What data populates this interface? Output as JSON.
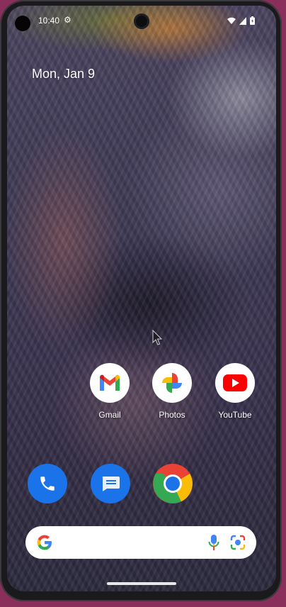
{
  "status_bar": {
    "time": "10:40",
    "gear_glyph": "⚙",
    "icons": [
      "wifi-icon",
      "signal-icon",
      "battery-icon"
    ]
  },
  "home": {
    "date": "Mon, Jan 9"
  },
  "apps": [
    {
      "label": "Gmail",
      "icon": "gmail-icon"
    },
    {
      "label": "Photos",
      "icon": "photos-icon"
    },
    {
      "label": "YouTube",
      "icon": "youtube-icon"
    }
  ],
  "dock": [
    {
      "icon": "phone-icon",
      "color": "#1a73e8"
    },
    {
      "icon": "messages-icon",
      "color": "#1a73e8"
    },
    {
      "icon": "chrome-icon"
    }
  ],
  "search": {
    "icons": [
      "google-g-icon",
      "mic-icon",
      "lens-icon"
    ]
  },
  "colors": {
    "frame": "#1a1a1c",
    "outer_background": "#8a2e5c",
    "google_blue": "#4285f4",
    "google_red": "#ea4335",
    "google_yellow": "#fbbc05",
    "google_green": "#34a853"
  }
}
